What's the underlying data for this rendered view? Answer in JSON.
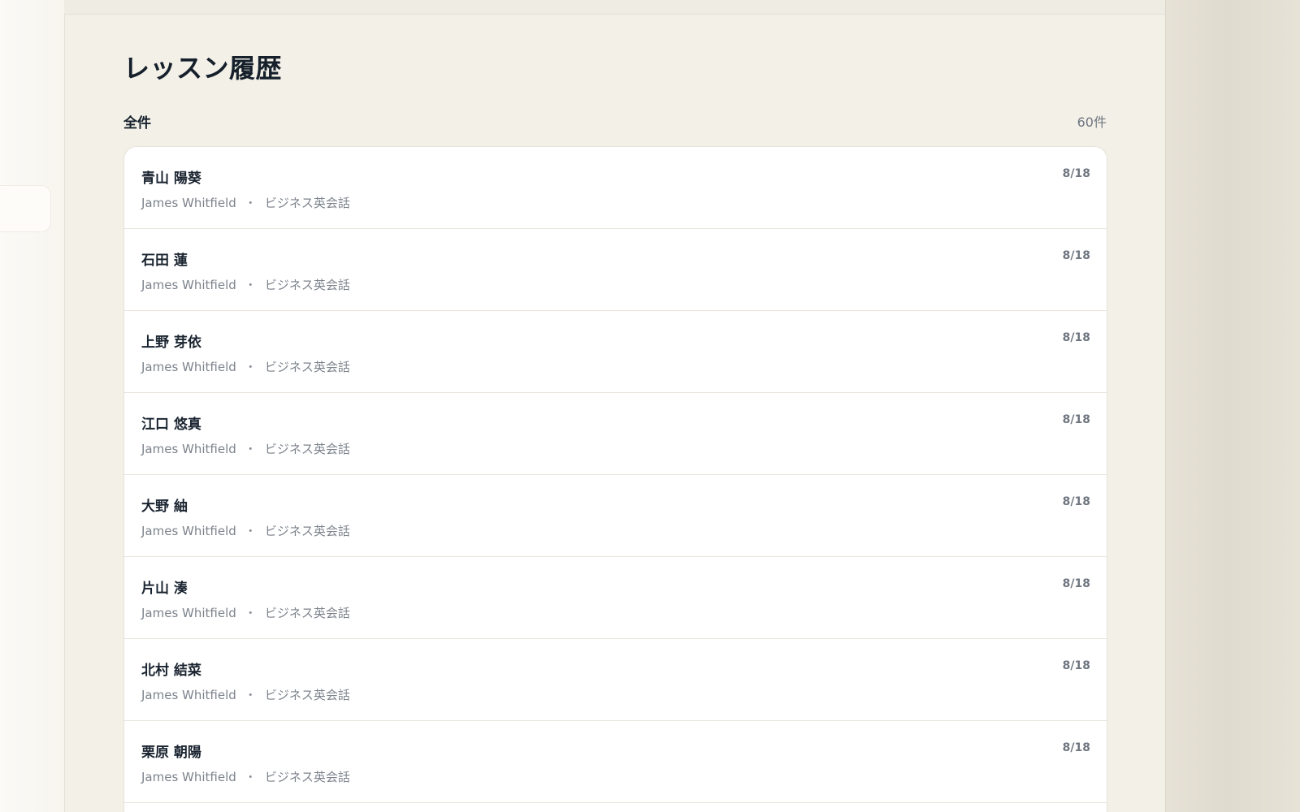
{
  "page": {
    "title": "レッスン履歴"
  },
  "section": {
    "label": "全件",
    "count": "60件"
  },
  "rows": [
    {
      "name": "青山 陽葵",
      "teacher": "James Whitfield",
      "separator": "・",
      "course": "ビジネス英会話",
      "date": "8/18"
    },
    {
      "name": "石田 蓮",
      "teacher": "James Whitfield",
      "separator": "・",
      "course": "ビジネス英会話",
      "date": "8/18"
    },
    {
      "name": "上野 芽依",
      "teacher": "James Whitfield",
      "separator": "・",
      "course": "ビジネス英会話",
      "date": "8/18"
    },
    {
      "name": "江口 悠真",
      "teacher": "James Whitfield",
      "separator": "・",
      "course": "ビジネス英会話",
      "date": "8/18"
    },
    {
      "name": "大野 紬",
      "teacher": "James Whitfield",
      "separator": "・",
      "course": "ビジネス英会話",
      "date": "8/18"
    },
    {
      "name": "片山 湊",
      "teacher": "James Whitfield",
      "separator": "・",
      "course": "ビジネス英会話",
      "date": "8/18"
    },
    {
      "name": "北村 結菜",
      "teacher": "James Whitfield",
      "separator": "・",
      "course": "ビジネス英会話",
      "date": "8/18"
    },
    {
      "name": "栗原 朝陽",
      "teacher": "James Whitfield",
      "separator": "・",
      "course": "ビジネス英会話",
      "date": "8/18"
    }
  ],
  "colors": {
    "background": "#f3f0e8",
    "card": "#ffffff",
    "text_primary": "#15202b",
    "text_secondary": "#7d838c",
    "border": "#e7e3db"
  }
}
